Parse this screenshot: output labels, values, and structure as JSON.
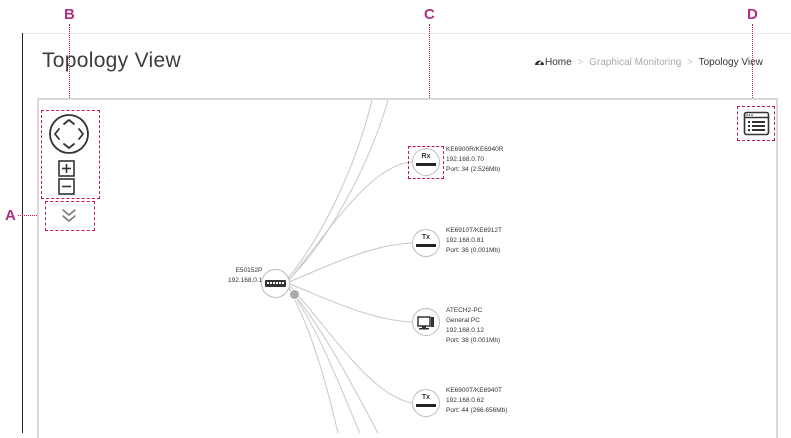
{
  "callouts": {
    "a": "A",
    "b": "B",
    "c": "C",
    "d": "D"
  },
  "page": {
    "title": "Topology View"
  },
  "breadcrumb": {
    "home": "Home",
    "separator": ">",
    "graphical_monitoring": "Graphical Monitoring",
    "current": "Topology View"
  },
  "icons": {
    "pan": "pan-arrows-icon",
    "zoom_in": "zoom-in-icon",
    "zoom_out": "zoom-out-icon",
    "expand": "double-chevron-down-icon",
    "list_view": "list-view-icon",
    "home": "dashboard-home-icon"
  },
  "colors": {
    "callout": "#b0307f",
    "dash": "#c2185b",
    "link": "#cccccc"
  },
  "topology": {
    "root": {
      "name": "E50152P",
      "ip": "192.168.0.1"
    },
    "nodes": [
      {
        "badge": "Rx",
        "model": "KE6900R/KE6940R",
        "ip": "192.168.0.70",
        "port": "Port: 34 (2.526Mb)"
      },
      {
        "badge": "Tx",
        "model": "KE6910T/KE6912T",
        "ip": "192.168.0.81",
        "port": "Port: 36 (0.001Mb)"
      },
      {
        "badge": "",
        "model": "ATECH2-PC",
        "type": "General PC",
        "ip": "192.168.0.12",
        "port": "Port: 38 (0.001Mb)"
      },
      {
        "badge": "Tx",
        "model": "KE6900T/KE6940T",
        "ip": "192.168.0.62",
        "port": "Port: 44 (266.656Mb)"
      }
    ]
  }
}
